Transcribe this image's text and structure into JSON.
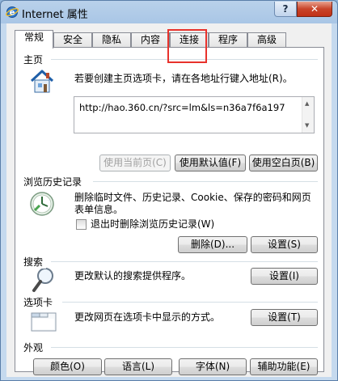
{
  "window": {
    "title": "Internet 属性",
    "help_label": "?",
    "close_label": "✕"
  },
  "tabs": [
    {
      "label": "常规",
      "active": true
    },
    {
      "label": "安全"
    },
    {
      "label": "隐私"
    },
    {
      "label": "内容"
    },
    {
      "label": "连接"
    },
    {
      "label": "程序"
    },
    {
      "label": "高级"
    }
  ],
  "home": {
    "title": "主页",
    "description": "若要创建主页选项卡，请在各地址行键入地址(R)。",
    "url": "http://hao.360.cn/?src=lm&ls=n36a7f6a197",
    "use_current": "使用当前页(C)",
    "use_default": "使用默认值(F)",
    "use_blank": "使用空白页(B)"
  },
  "history": {
    "title": "浏览历史记录",
    "description_line1": "删除临时文件、历史记录、Cookie、保存的密码和网页",
    "description_line2": "表单信息。",
    "checkbox_label": "退出时删除浏览历史记录(W)",
    "checkbox_checked": false,
    "delete_button": "删除(D)...",
    "settings_button": "设置(S)"
  },
  "search": {
    "title": "搜索",
    "description": "更改默认的搜索提供程序。",
    "settings_button": "设置(I)"
  },
  "tabs_section": {
    "title": "选项卡",
    "description": "更改网页在选项卡中显示的方式。",
    "settings_button": "设置(T)"
  },
  "appearance": {
    "title": "外观",
    "colors_button": "颜色(O)",
    "languages_button": "语言(L)",
    "fonts_button": "字体(N)",
    "accessibility_button": "辅助功能(E)"
  },
  "colors": {
    "highlight": "#e8322c",
    "title_gradient_top": "#b9d1ea",
    "close_button": "#c8442a"
  }
}
